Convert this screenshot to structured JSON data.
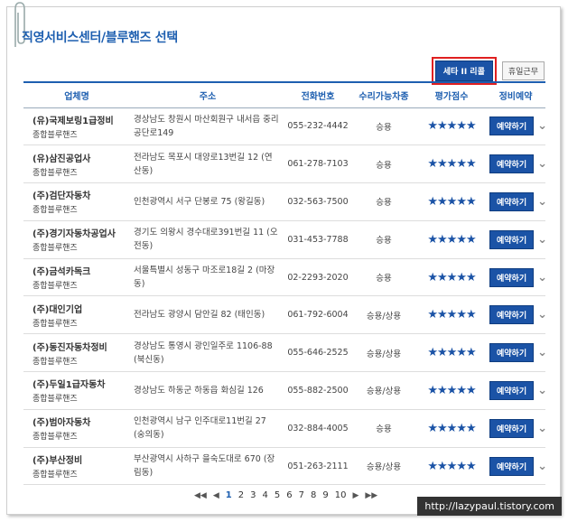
{
  "page_title": "직영서비스센터/블루핸즈 선택",
  "buttons": {
    "filter_label": "세타 II 리콜",
    "closed_label": "휴일근무"
  },
  "columns": [
    "업체명",
    "주소",
    "전화번호",
    "수리가능차종",
    "평가점수",
    "정비예약"
  ],
  "reserve_label": "예약하기",
  "rows": [
    {
      "name": "(유)국제보링1급정비",
      "type": "종합블루핸즈",
      "address": "경상남도 창원시 마산회원구 내서읍 중리 공단로149",
      "phone": "055-232-4442",
      "vehicle": "승용",
      "rating": 5
    },
    {
      "name": "(유)삼진공업사",
      "type": "종합블루핸즈",
      "address": "전라남도 목포시 대양로13번길 12 (연산동)",
      "phone": "061-278-7103",
      "vehicle": "승용",
      "rating": 5
    },
    {
      "name": "(주)검단자동차",
      "type": "종합블루핸즈",
      "address": "인천광역시 서구 단봉로 75 (왕길동)",
      "phone": "032-563-7500",
      "vehicle": "승용",
      "rating": 5
    },
    {
      "name": "(주)경기자동차공업사",
      "type": "종합블루핸즈",
      "address": "경기도 의왕시 경수대로391번길 11 (오전동)",
      "phone": "031-453-7788",
      "vehicle": "승용",
      "rating": 5
    },
    {
      "name": "(주)금석카독크",
      "type": "종합블루핸즈",
      "address": "서울특별시 성동구 마조로18길 2 (마장동)",
      "phone": "02-2293-2020",
      "vehicle": "승용",
      "rating": 5
    },
    {
      "name": "(주)대인기업",
      "type": "종합블루핸즈",
      "address": "전라남도 광양시 담안길 82 (태인동)",
      "phone": "061-792-6004",
      "vehicle": "승용/상용",
      "rating": 5
    },
    {
      "name": "(주)동진자동차정비",
      "type": "종합블루핸즈",
      "address": "경상남도 통영시 광인일주로 1106-88 (북신동)",
      "phone": "055-646-2525",
      "vehicle": "승용/상용",
      "rating": 5
    },
    {
      "name": "(주)두일1급자동차",
      "type": "종합블루핸즈",
      "address": "경상남도 하동군 하동읍 화심길 126",
      "phone": "055-882-2500",
      "vehicle": "승용/상용",
      "rating": 5
    },
    {
      "name": "(주)범아자동차",
      "type": "종합블루핸즈",
      "address": "인천광역시 남구 인주대로11번길 27 (숭의동)",
      "phone": "032-884-4005",
      "vehicle": "승용",
      "rating": 5
    },
    {
      "name": "(주)부산정비",
      "type": "종합블루핸즈",
      "address": "부산광역시 사하구 을숙도대로 670 (장림동)",
      "phone": "051-263-2111",
      "vehicle": "승용/상용",
      "rating": 5
    }
  ],
  "pagination": {
    "pages": [
      "1",
      "2",
      "3",
      "4",
      "5",
      "6",
      "7",
      "8",
      "9",
      "10"
    ],
    "current": "1"
  },
  "watermark": "http://lazypaul.tistory.com",
  "colors": {
    "accent": "#1e5fb0",
    "button": "#1b53a6",
    "highlight": "#e02020"
  }
}
